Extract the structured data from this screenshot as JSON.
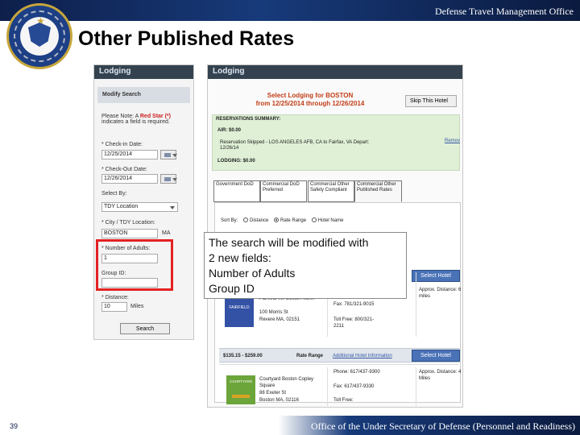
{
  "header": {
    "organization": "Defense Travel Management Office",
    "title": "Other Published Rates"
  },
  "left_panel": {
    "section_title": "Lodging",
    "modify_search": "Modify Search",
    "note_prefix": "Please Note: A ",
    "red_star_text": "Red Star (*)",
    "note_suffix": "indicates a field is required.",
    "check_in_label": "* Check-in Date:",
    "check_in_value": "12/25/2014",
    "check_out_label": "* Check-Out Date:",
    "check_out_value": "12/26/2014",
    "select_by_label": "Select By:",
    "select_by_value": "TDY Location",
    "city_label": "* City / TDY Location:",
    "city_value": "BOSTON",
    "state_value": "MA",
    "adults_label": "* Number of Adults:",
    "adults_value": "1",
    "group_label": "Group ID:",
    "distance_label": "* Distance:",
    "distance_value": "10",
    "distance_unit": "Miles",
    "search_button": "Search"
  },
  "right_panel": {
    "section_title": "Lodging",
    "heading_line1": "Select Lodging for BOSTON",
    "heading_line2": "from 12/25/2014 through 12/26/2014",
    "skip_button": "Skip This Hotel",
    "reservations_summary": "RESERVATIONS SUMMARY:",
    "air": "AIR:   $0.00",
    "reservation_skipped": "Reservation Skipped - LOS ANGELES AFB, CA to Fairfax, VA Depart:",
    "reservation_date": "12/26/14",
    "remove_link": "Remov",
    "lodging_total": "LODGING:   $0.00",
    "tabs": [
      "Government DoD",
      "Commercial DoD Preferred",
      "Commercial Other Safety Compliant",
      "Commercial Other Published Rates"
    ],
    "sort_by": "Sort By:",
    "sort_distance": "Distance",
    "sort_rate": "Rate Range",
    "sort_name": "Hotel Name",
    "overlay_lines": [
      "The search will be modified with",
      "2 new fields:",
      "Number of Adults",
      "Group ID"
    ],
    "hotels": [
      {
        "logo": "FAIRFIELD",
        "name": "Fairfield Inn Boston North",
        "address1": "100 Morris St",
        "address2": "Revere MA, 02151",
        "fax": "Fax: 781/321-9015",
        "toll_free": "Toll Free: 800/321-2211",
        "distance": "Approx. Distance: 6 miles",
        "select_button": "Select Hotel"
      },
      {
        "rate_range": "$135.15 - $259.00",
        "rate_range_label": "Rate Range",
        "additional_info": "Additional Hotel Information",
        "logo": "COURTYARD",
        "name": "Courtyard Boston Copley Square",
        "address1": "88 Exeter St",
        "address2": "Boston MA, 02116",
        "phone": "Phone: 617/437-9300",
        "fax": "Fax: 617/437-9330",
        "toll_free": "Toll Free:",
        "distance": "Approx. Distance: 4 Miles",
        "select_button": "Select Hotel"
      }
    ]
  },
  "footer": {
    "slide_number": "39",
    "office": "Office of the Under Secretary of Defense (Personnel and Readiness)"
  }
}
